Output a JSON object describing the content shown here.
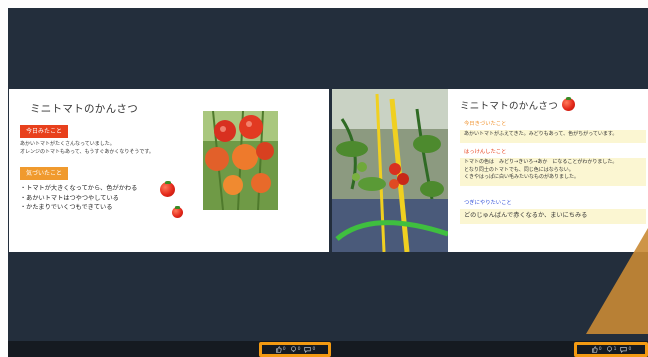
{
  "left_slide": {
    "title": "ミニトマトのかんさつ",
    "section1_label": "今日みたこと",
    "section1_text": "あかいトマトがたくさんなっていました。\nオレンジのトマトもあって、もうすぐあかくなりそうです。",
    "section2_label": "気づいたこと",
    "section2_bullets": "・トマトが大きくなってから、色がかわる\n・あかいトマトはつやつやしている\n・かたまりでいくつもできている"
  },
  "right_slide": {
    "title": "ミニトマトのかんさつ",
    "heading1": "今日きづいたこと",
    "text1": "あかいトマトがふえてきた。みどりもあって、色がちがっています。",
    "heading2": "はっけんしたこと",
    "text2": "トマトの色は　みどり→きいろ→あか　になることがわかりました。\nとなり同士のトマトでも、同じ色にはならない。\nくきやはっぱに白い毛みたいなものがありました。",
    "heading3": "つぎにやりたいこと",
    "text3": "どのじゅんばんで赤くなるか、まいにちみる"
  },
  "reaction_bar_left": {
    "like_count": "0",
    "idea_count": "0",
    "comment_count": "0"
  },
  "reaction_bar_right": {
    "like_count": "0",
    "idea_count": "1",
    "comment_count": "0"
  },
  "colors": {
    "background": "#232e3c",
    "highlight": "#f39a12",
    "red_label": "#e8401c",
    "orange_label": "#f09a2e"
  }
}
